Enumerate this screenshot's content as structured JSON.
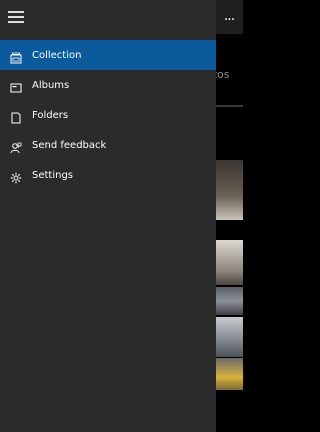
{
  "header": {
    "more_label": "..."
  },
  "background": {
    "section_label": "otos"
  },
  "drawer": {
    "items": [
      {
        "label": "Collection",
        "icon": "collection-icon",
        "selected": true
      },
      {
        "label": "Albums",
        "icon": "albums-icon",
        "selected": false
      },
      {
        "label": "Folders",
        "icon": "folders-icon",
        "selected": false
      },
      {
        "label": "Send feedback",
        "icon": "feedback-icon",
        "selected": false
      },
      {
        "label": "Settings",
        "icon": "gear-icon",
        "selected": false
      }
    ]
  },
  "colors": {
    "accent": "#0a5a9c",
    "drawer_bg": "#2b2b2b",
    "topbar_bg": "#1f1f1f"
  }
}
